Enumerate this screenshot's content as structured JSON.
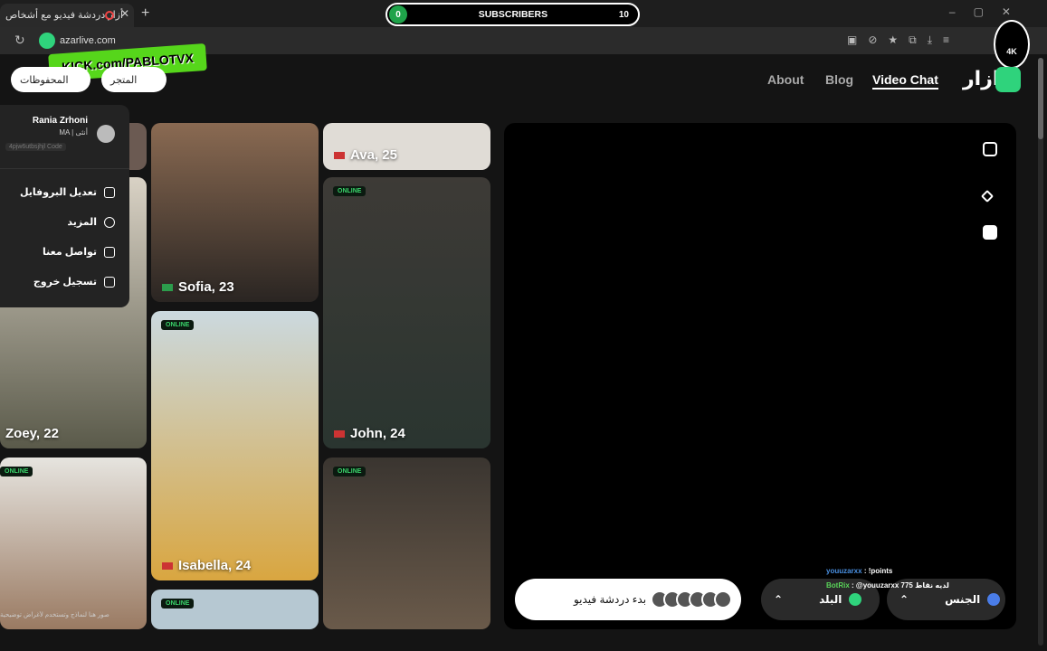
{
  "browser": {
    "tab_title": "أزار دردشة فيديو مع أشخاص",
    "new_tab": "+",
    "url": "azarlive.com"
  },
  "overlay": {
    "subscribers_label": "SUBSCRIBERS",
    "subscribers_current": "0",
    "subscribers_goal": "10",
    "kick_logo": "KICK.com/PABLOTVX",
    "channel_badge": "4K"
  },
  "header": {
    "saved_label": "المحفوظات",
    "store_label": "المتجر",
    "nav": [
      "About",
      "Blog",
      "Video Chat"
    ],
    "brand_name": "ازار"
  },
  "profile_menu": {
    "name": "Rania Zrhoni",
    "meta": "MA | أنثى",
    "code_value": "4pjw6utbsjhjl",
    "code_label": "Code",
    "items": [
      "تعديل البروفايل",
      "المزيد",
      "تواصل معنا",
      "تسجيل خروج"
    ]
  },
  "cards": [
    {
      "name": "Ava, 25",
      "online": false
    },
    {
      "name": "Sofia, 23",
      "online": false
    },
    {
      "name": "John, 24",
      "online": true
    },
    {
      "name": "Zoey, 22",
      "online": false
    },
    {
      "name": "Isabella, 24",
      "online": true
    },
    {
      "name": "",
      "online": true
    },
    {
      "name": "",
      "online": true
    },
    {
      "name": "",
      "online": true
    }
  ],
  "online_label": "ONLINE",
  "video": {
    "start_label": "بدء دردشة فيديو",
    "gender_label": "الجنس",
    "country_label": "البلد"
  },
  "chat": {
    "line1_user": "youuzarxx",
    "line1_text": ": !points",
    "line2_user": "BotRix",
    "line2_text": ": @youuzarxx 775 لديه نقاط"
  },
  "caption": "صور هنا لنماذج وتستخدم لأغراض توضيحية"
}
